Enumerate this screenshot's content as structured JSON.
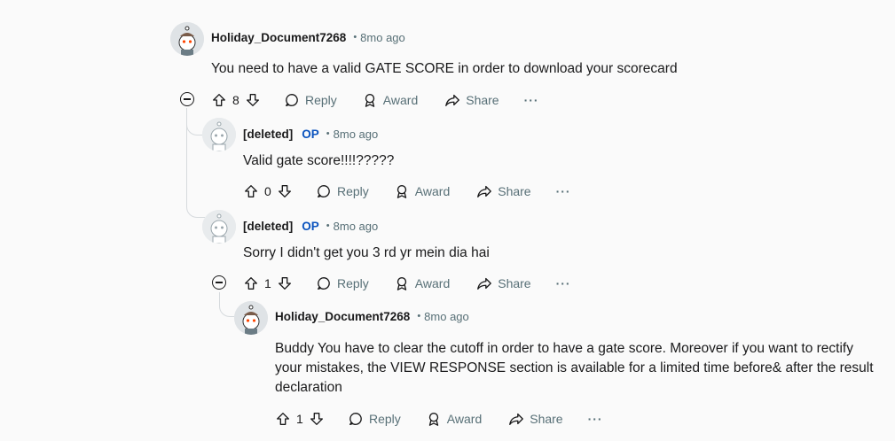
{
  "comments": [
    {
      "author": "Holiday_Document7268",
      "op_badge": "",
      "time": "8mo ago",
      "body": "You need to have a valid GATE SCORE in order to download your scorecard",
      "score": "8",
      "reply_label": "Reply",
      "award_label": "Award",
      "share_label": "Share",
      "more_label": "···",
      "avatar_icon": "snoo-avatar-icon"
    },
    {
      "author": "[deleted]",
      "op_badge": "OP",
      "time": "8mo ago",
      "body": "Valid gate score!!!!?????",
      "score": "0",
      "reply_label": "Reply",
      "award_label": "Award",
      "share_label": "Share",
      "more_label": "···",
      "avatar_icon": "deleted-user-avatar-icon"
    },
    {
      "author": "[deleted]",
      "op_badge": "OP",
      "time": "8mo ago",
      "body": "Sorry I didn't get you 3 rd yr mein dia hai",
      "score": "1",
      "reply_label": "Reply",
      "award_label": "Award",
      "share_label": "Share",
      "more_label": "···",
      "avatar_icon": "deleted-user-avatar-icon"
    },
    {
      "author": "Holiday_Document7268",
      "op_badge": "",
      "time": "8mo ago",
      "body": "Buddy You have to clear the cutoff in order to have a gate score. Moreover if you want to rectify your mistakes, the VIEW RESPONSE section is available for a limited time before& after the result declaration",
      "score": "1",
      "reply_label": "Reply",
      "award_label": "Award",
      "share_label": "Share",
      "more_label": "···",
      "avatar_icon": "snoo-avatar-icon"
    }
  ],
  "colors": {
    "background": "#fafafa",
    "op_badge": "#0a53be",
    "meta_text": "#576f76",
    "thread_line": "#d6dadd"
  }
}
